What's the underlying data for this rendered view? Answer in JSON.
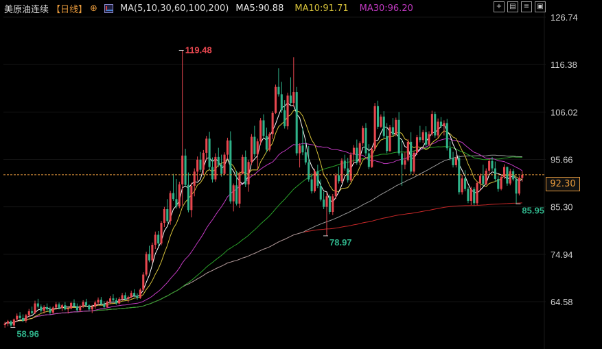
{
  "header": {
    "instrument": "美原油连续",
    "period": "【日线】",
    "indicator": "MA(5,10,30,60,100,200)",
    "ma5": "MA5:90.88",
    "ma10": "MA10:91.71",
    "ma30": "MA30:96.20"
  },
  "toolbar": [
    "+",
    "▤",
    "≡",
    "▣"
  ],
  "colors": {
    "up": "#e8474f",
    "down": "#2fb38a",
    "ma5": "#ffffff",
    "ma10": "#d6c13a",
    "ma30": "#c23ac2",
    "ma60": "#2aa32a",
    "ma100": "#9a9a9a",
    "ma200": "#c82828",
    "axis_text": "#d0d0d0",
    "current_price": "#e89a3c"
  },
  "current_price": {
    "value": 92.3,
    "label": "92.30"
  },
  "chart_data": {
    "type": "candlestick",
    "ylim": [
      56,
      127
    ],
    "y_ticks": [
      {
        "v": 126.74,
        "label": "126.74"
      },
      {
        "v": 116.38,
        "label": "116.38"
      },
      {
        "v": 106.02,
        "label": "106.02"
      },
      {
        "v": 95.66,
        "label": "95.66"
      },
      {
        "v": 85.3,
        "label": "85.30"
      },
      {
        "v": 74.94,
        "label": "74.94"
      },
      {
        "v": 64.58,
        "label": "64.58"
      }
    ],
    "annotations": [
      {
        "label": "119.48",
        "idx": 59,
        "v": 119.48,
        "color": "#e8474f",
        "pos": "above"
      },
      {
        "label": "78.97",
        "idx": 107,
        "v": 78.97,
        "color": "#2fb38a",
        "pos": "below"
      },
      {
        "label": "85.95",
        "idx": 171,
        "v": 85.95,
        "color": "#2fb38a",
        "pos": "below"
      },
      {
        "label": "58.96",
        "idx": 3,
        "v": 58.96,
        "color": "#2fb38a",
        "pos": "below"
      }
    ],
    "candles": [
      [
        59.5,
        60.2,
        58.9,
        59.8
      ],
      [
        59.8,
        60.6,
        59.2,
        60.3
      ],
      [
        60.3,
        60.5,
        59.1,
        59.4
      ],
      [
        59.4,
        60.9,
        58.96,
        60.7
      ],
      [
        60.7,
        62.0,
        60.2,
        61.5
      ],
      [
        61.5,
        62.3,
        60.8,
        61.0
      ],
      [
        61.0,
        61.8,
        60.1,
        60.4
      ],
      [
        60.4,
        61.9,
        60.0,
        61.6
      ],
      [
        61.6,
        63.0,
        61.2,
        62.5
      ],
      [
        62.5,
        63.5,
        61.8,
        62.1
      ],
      [
        62.1,
        64.8,
        61.9,
        64.2
      ],
      [
        64.2,
        65.2,
        63.1,
        63.5
      ],
      [
        63.5,
        64.0,
        62.2,
        62.6
      ],
      [
        62.6,
        63.8,
        62.0,
        63.4
      ],
      [
        63.4,
        64.2,
        62.5,
        62.9
      ],
      [
        62.9,
        63.5,
        61.8,
        62.2
      ],
      [
        62.2,
        63.6,
        61.9,
        63.3
      ],
      [
        63.3,
        64.5,
        62.8,
        64.0
      ],
      [
        64.0,
        64.4,
        62.9,
        63.2
      ],
      [
        63.2,
        64.1,
        62.5,
        63.8
      ],
      [
        63.8,
        64.5,
        62.7,
        62.9
      ],
      [
        62.9,
        63.6,
        62.0,
        63.1
      ],
      [
        63.1,
        64.6,
        62.9,
        64.3
      ],
      [
        64.3,
        65.1,
        63.4,
        63.6
      ],
      [
        63.6,
        64.2,
        62.4,
        62.7
      ],
      [
        62.7,
        63.9,
        62.3,
        63.6
      ],
      [
        63.6,
        64.9,
        63.2,
        64.5
      ],
      [
        64.5,
        65.2,
        63.5,
        63.8
      ],
      [
        63.8,
        64.0,
        62.6,
        62.9
      ],
      [
        62.9,
        63.9,
        62.1,
        63.5
      ],
      [
        63.5,
        64.8,
        63.0,
        64.4
      ],
      [
        64.4,
        65.5,
        63.8,
        65.0
      ],
      [
        65.0,
        65.6,
        63.9,
        64.1
      ],
      [
        64.1,
        64.7,
        63.0,
        63.4
      ],
      [
        63.4,
        64.8,
        63.2,
        64.6
      ],
      [
        64.6,
        65.8,
        64.0,
        65.3
      ],
      [
        65.3,
        66.2,
        64.6,
        64.9
      ],
      [
        64.9,
        65.4,
        63.9,
        64.2
      ],
      [
        64.2,
        65.6,
        64.0,
        65.2
      ],
      [
        65.2,
        66.5,
        64.8,
        66.0
      ],
      [
        66.0,
        66.6,
        64.9,
        65.2
      ],
      [
        65.2,
        65.9,
        64.4,
        65.6
      ],
      [
        65.6,
        67.0,
        65.3,
        66.5
      ],
      [
        66.5,
        67.3,
        65.6,
        65.9
      ],
      [
        65.9,
        66.4,
        65.0,
        65.4
      ],
      [
        65.4,
        67.5,
        65.2,
        67.2
      ],
      [
        67.2,
        71.0,
        66.8,
        70.5
      ],
      [
        70.5,
        75.5,
        70.1,
        75.0
      ],
      [
        75.0,
        76.8,
        73.2,
        73.6
      ],
      [
        73.6,
        77.5,
        73.1,
        77.0
      ],
      [
        77.0,
        79.9,
        76.1,
        79.2
      ],
      [
        79.2,
        80.0,
        76.7,
        77.3
      ],
      [
        77.3,
        82.2,
        76.9,
        81.8
      ],
      [
        81.8,
        85.3,
        80.9,
        84.8
      ],
      [
        84.8,
        87.0,
        81.8,
        82.2
      ],
      [
        82.2,
        88.8,
        81.4,
        88.3
      ],
      [
        88.3,
        92.5,
        86.6,
        87.0
      ],
      [
        87.0,
        91.4,
        84.9,
        85.4
      ],
      [
        85.4,
        90.8,
        85.0,
        90.2
      ],
      [
        90.2,
        119.48,
        85.6,
        96.5
      ],
      [
        96.5,
        98.0,
        89.6,
        90.1
      ],
      [
        90.1,
        92.8,
        84.1,
        84.6
      ],
      [
        84.6,
        90.6,
        83.0,
        89.9
      ],
      [
        89.9,
        93.7,
        87.6,
        93.0
      ],
      [
        93.0,
        96.3,
        91.0,
        95.6
      ],
      [
        95.6,
        97.3,
        92.9,
        93.4
      ],
      [
        93.4,
        97.7,
        92.3,
        97.1
      ],
      [
        97.1,
        100.8,
        95.4,
        100.2
      ],
      [
        100.2,
        101.7,
        93.3,
        94.0
      ],
      [
        94.0,
        96.1,
        90.6,
        91.3
      ],
      [
        91.3,
        97.0,
        90.8,
        96.2
      ],
      [
        96.2,
        98.2,
        94.0,
        94.5
      ],
      [
        94.5,
        96.7,
        91.9,
        92.5
      ],
      [
        92.5,
        97.2,
        92.3,
        96.7
      ],
      [
        96.7,
        100.4,
        95.7,
        99.8
      ],
      [
        99.8,
        101.8,
        86.0,
        86.5
      ],
      [
        86.5,
        90.4,
        84.3,
        90.0
      ],
      [
        90.0,
        93.2,
        85.6,
        86.0
      ],
      [
        86.0,
        93.0,
        85.1,
        92.5
      ],
      [
        92.5,
        96.7,
        92.4,
        96.2
      ],
      [
        96.2,
        97.6,
        89.6,
        90.2
      ],
      [
        90.2,
        95.6,
        88.6,
        95.1
      ],
      [
        95.1,
        101.2,
        94.5,
        100.6
      ],
      [
        100.6,
        103.0,
        96.2,
        96.8
      ],
      [
        96.8,
        100.2,
        93.5,
        99.6
      ],
      [
        99.6,
        104.7,
        98.9,
        104.2
      ],
      [
        104.2,
        105.5,
        100.2,
        100.8
      ],
      [
        100.8,
        102.6,
        97.2,
        97.8
      ],
      [
        97.8,
        101.6,
        97.4,
        101.2
      ],
      [
        101.2,
        106.2,
        100.1,
        105.8
      ],
      [
        105.8,
        112.0,
        105.6,
        111.5
      ],
      [
        111.5,
        115.6,
        109.4,
        109.9
      ],
      [
        109.9,
        112.6,
        105.8,
        106.4
      ],
      [
        106.4,
        108.6,
        102.4,
        102.9
      ],
      [
        102.9,
        110.2,
        102.2,
        109.6
      ],
      [
        109.6,
        113.6,
        107.4,
        108.0
      ],
      [
        108.0,
        118.0,
        107.1,
        110.4
      ],
      [
        110.4,
        111.5,
        96.5,
        97.0
      ],
      [
        97.0,
        99.2,
        93.9,
        98.7
      ],
      [
        98.7,
        102.5,
        96.6,
        97.2
      ],
      [
        97.2,
        99.8,
        94.5,
        95.0
      ],
      [
        95.0,
        98.6,
        90.8,
        91.3
      ],
      [
        91.3,
        92.6,
        88.2,
        88.7
      ],
      [
        88.7,
        93.6,
        88.4,
        93.1
      ],
      [
        93.1,
        94.5,
        89.4,
        89.9
      ],
      [
        89.9,
        91.3,
        86.5,
        86.9
      ],
      [
        86.9,
        88.6,
        84.8,
        85.3
      ],
      [
        85.3,
        88.4,
        78.97,
        87.6
      ],
      [
        87.6,
        88.0,
        83.7,
        84.2
      ],
      [
        84.2,
        88.1,
        83.5,
        87.6
      ],
      [
        87.6,
        92.7,
        87.0,
        92.2
      ],
      [
        92.2,
        94.1,
        90.4,
        90.9
      ],
      [
        90.9,
        95.9,
        90.5,
        95.4
      ],
      [
        95.4,
        96.7,
        93.2,
        93.7
      ],
      [
        93.7,
        96.0,
        90.6,
        91.1
      ],
      [
        91.1,
        97.2,
        90.8,
        96.7
      ],
      [
        96.7,
        98.8,
        94.6,
        98.2
      ],
      [
        98.2,
        100.0,
        94.5,
        95.0
      ],
      [
        95.0,
        99.6,
        94.4,
        99.2
      ],
      [
        99.2,
        103.0,
        98.6,
        102.5
      ],
      [
        102.5,
        103.6,
        96.4,
        97.0
      ],
      [
        97.0,
        99.0,
        93.5,
        94.0
      ],
      [
        94.0,
        98.4,
        93.8,
        98.0
      ],
      [
        98.0,
        108.0,
        97.6,
        107.3
      ],
      [
        107.3,
        108.5,
        102.3,
        102.8
      ],
      [
        102.8,
        105.5,
        102.5,
        105.0
      ],
      [
        105.0,
        106.2,
        100.3,
        100.8
      ],
      [
        100.8,
        103.6,
        97.0,
        97.5
      ],
      [
        97.5,
        103.2,
        97.3,
        102.7
      ],
      [
        102.7,
        104.7,
        100.6,
        101.1
      ],
      [
        101.1,
        104.8,
        100.7,
        104.3
      ],
      [
        104.3,
        106.0,
        96.5,
        97.0
      ],
      [
        97.0,
        100.0,
        89.9,
        94.5
      ],
      [
        94.5,
        97.2,
        93.5,
        95.5
      ],
      [
        95.5,
        100.1,
        95.2,
        99.5
      ],
      [
        99.5,
        101.6,
        92.4,
        93.0
      ],
      [
        93.0,
        97.6,
        92.5,
        97.1
      ],
      [
        97.1,
        101.0,
        96.6,
        100.5
      ],
      [
        100.5,
        103.0,
        99.4,
        99.9
      ],
      [
        99.9,
        102.1,
        99.2,
        101.6
      ],
      [
        101.6,
        102.9,
        98.5,
        98.9
      ],
      [
        98.9,
        101.8,
        98.7,
        101.2
      ],
      [
        101.2,
        106.3,
        100.8,
        105.6
      ],
      [
        105.6,
        106.1,
        100.4,
        100.9
      ],
      [
        100.9,
        104.6,
        100.2,
        103.9
      ],
      [
        103.9,
        104.9,
        102.5,
        102.9
      ],
      [
        102.9,
        104.2,
        100.9,
        103.6
      ],
      [
        103.6,
        104.5,
        97.6,
        98.1
      ],
      [
        98.1,
        99.6,
        95.4,
        95.9
      ],
      [
        95.9,
        97.3,
        93.9,
        94.4
      ],
      [
        94.4,
        96.6,
        93.9,
        96.0
      ],
      [
        96.0,
        96.6,
        88.0,
        88.5
      ],
      [
        88.5,
        92.3,
        88.0,
        91.5
      ],
      [
        91.5,
        93.3,
        88.7,
        89.2
      ],
      [
        89.2,
        89.7,
        86.1,
        86.6
      ],
      [
        86.6,
        89.7,
        85.7,
        89.2
      ],
      [
        89.2,
        89.6,
        85.6,
        86.1
      ],
      [
        86.1,
        90.9,
        85.7,
        90.5
      ],
      [
        90.5,
        92.6,
        88.8,
        92.1
      ],
      [
        92.1,
        94.5,
        89.8,
        90.3
      ],
      [
        90.3,
        93.7,
        90.0,
        93.2
      ],
      [
        93.2,
        95.8,
        92.5,
        95.3
      ],
      [
        95.3,
        96.2,
        93.2,
        93.7
      ],
      [
        93.7,
        95.2,
        90.8,
        91.4
      ],
      [
        91.4,
        92.0,
        88.6,
        89.2
      ],
      [
        89.2,
        92.3,
        88.9,
        91.8
      ],
      [
        91.8,
        94.6,
        91.4,
        94.0
      ],
      [
        94.0,
        94.1,
        89.9,
        90.4
      ],
      [
        90.4,
        93.6,
        90.0,
        93.1
      ],
      [
        93.1,
        93.6,
        90.9,
        91.3
      ],
      [
        91.3,
        91.6,
        85.95,
        88.2
      ],
      [
        88.2,
        92.1,
        87.8,
        91.6
      ],
      [
        91.6,
        93.1,
        90.8,
        92.3
      ]
    ]
  }
}
